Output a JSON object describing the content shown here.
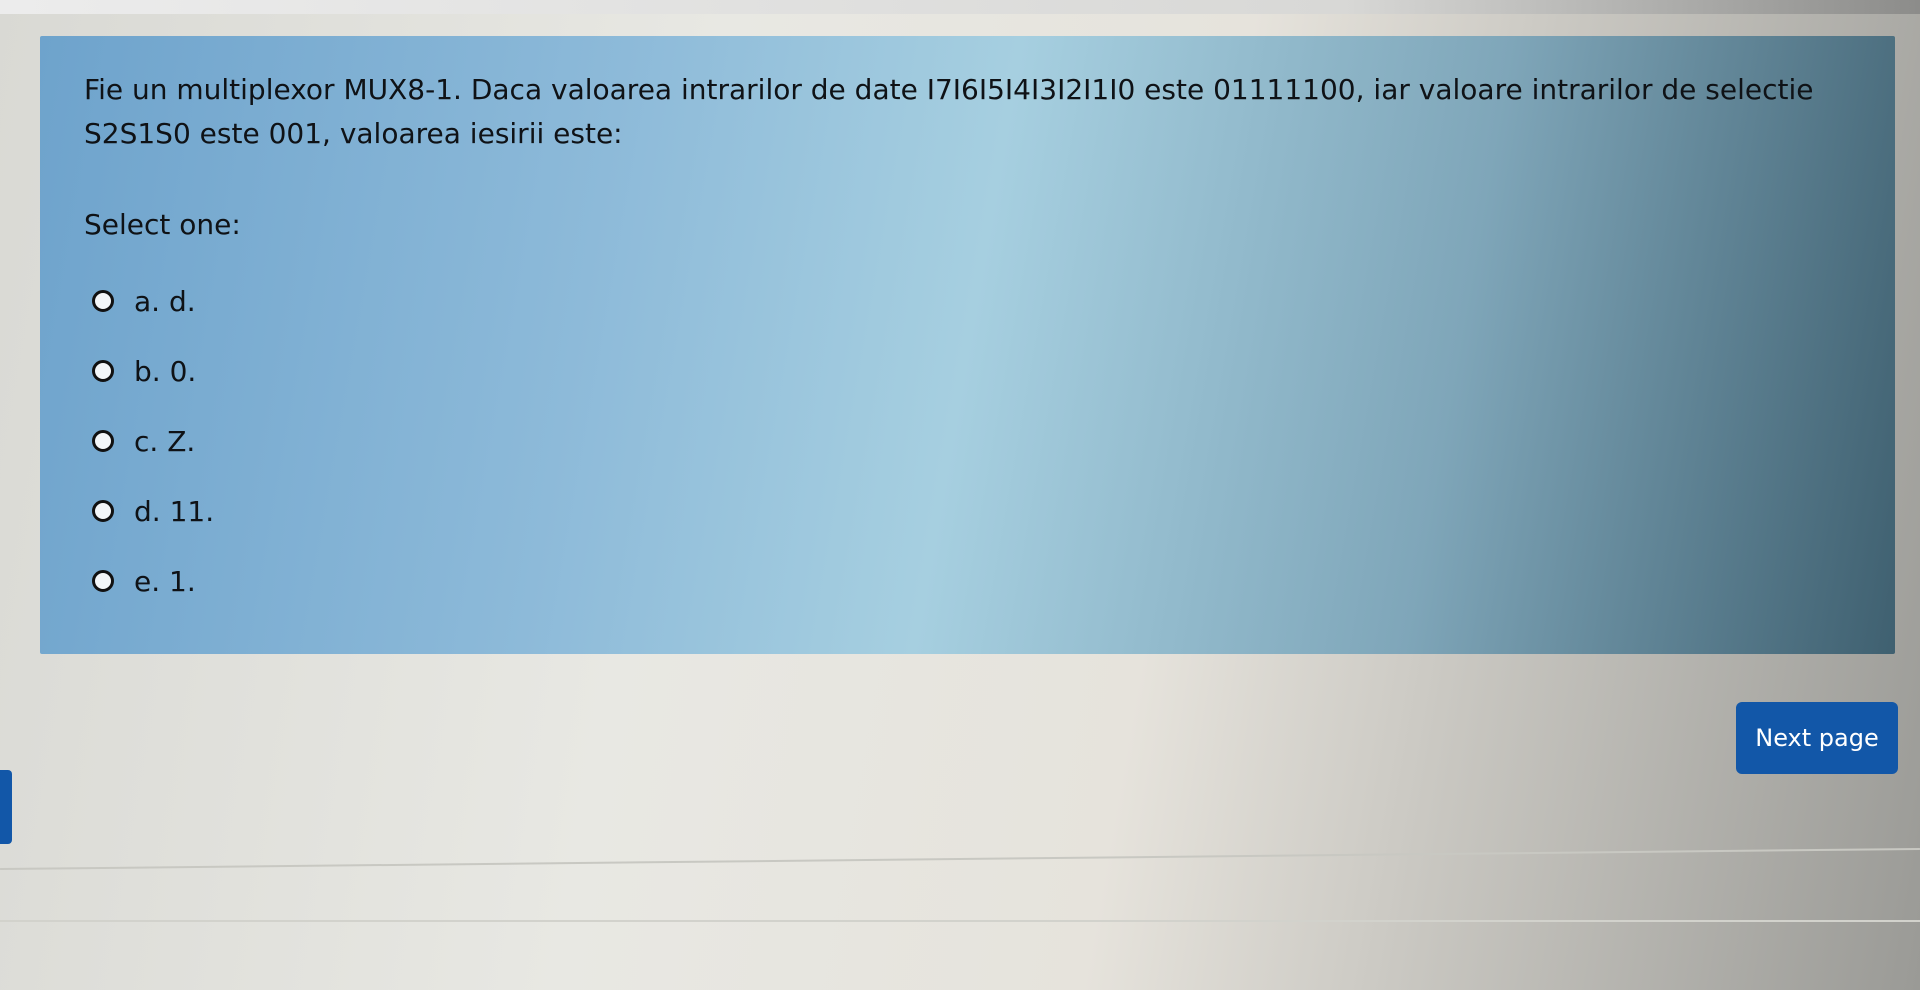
{
  "question": {
    "text": "Fie un multiplexor MUX8-1. Daca valoarea intrarilor de date I7I6I5I4I3I2I1I0 este 01111100, iar valoare intrarilor de selectie S2S1S0 este 001, valoarea iesirii este:",
    "select_prompt": "Select one:",
    "answers": [
      {
        "label": "a. d."
      },
      {
        "label": "b. 0."
      },
      {
        "label": "c. Z."
      },
      {
        "label": "d. 11."
      },
      {
        "label": "e. 1."
      }
    ]
  },
  "navigation": {
    "next_label": "Next page"
  },
  "colors": {
    "accent": "#1257a8",
    "panel": "#8dbad9"
  }
}
